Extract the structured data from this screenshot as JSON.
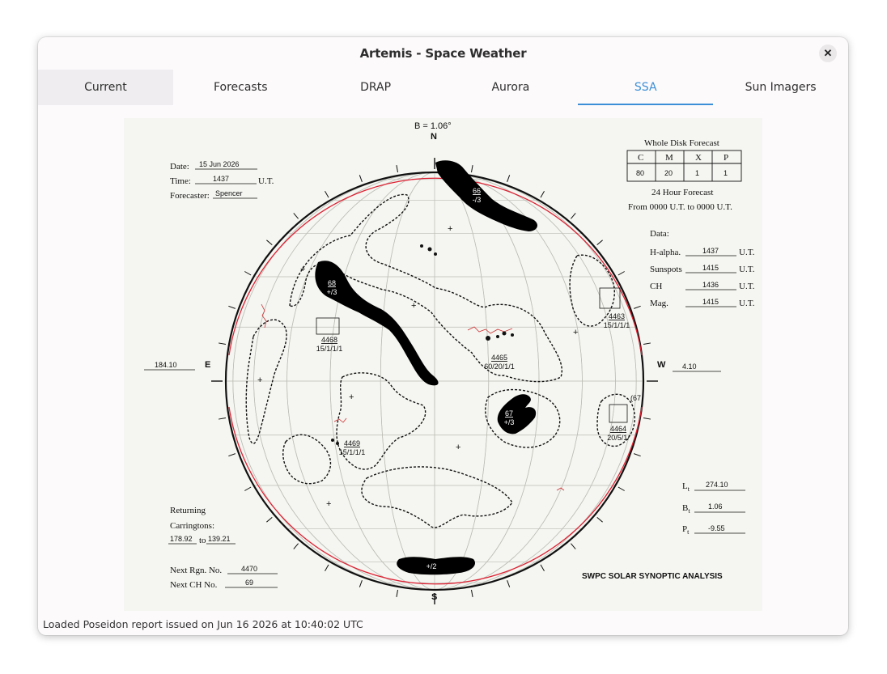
{
  "window": {
    "title": "Artemis - Space Weather",
    "close_icon": "close-icon"
  },
  "tabs": [
    {
      "label": "Current"
    },
    {
      "label": "Forecasts"
    },
    {
      "label": "DRAP"
    },
    {
      "label": "Aurora"
    },
    {
      "label": "SSA"
    },
    {
      "label": "Sun Imagers"
    }
  ],
  "selected_tab": "SSA",
  "ssa": {
    "b_angle": "B = 1.06°",
    "north": "N",
    "south": "S",
    "east": "E",
    "west": "W",
    "date_label": "Date:",
    "date_value": "15 Jun 2026",
    "time_label": "Time:",
    "time_value": "1437",
    "time_unit": "U.T.",
    "forecaster_label": "Forecaster:",
    "forecaster_value": "Spencer",
    "forecast_title": "Whole Disk Forecast",
    "forecast_headers": [
      "C",
      "M",
      "X",
      "P"
    ],
    "forecast_values": [
      "80",
      "20",
      "1",
      "1"
    ],
    "forecast_24h": "24 Hour Forecast",
    "forecast_range": "From 0000 U.T. to 0000 U.T.",
    "data_label": "Data:",
    "data_rows": [
      {
        "label": "H-alpha.",
        "value": "1437",
        "unit": "U.T."
      },
      {
        "label": "Sunspots",
        "value": "1415",
        "unit": "U.T."
      },
      {
        "label": "CH",
        "value": "1436",
        "unit": "U.T."
      },
      {
        "label": "Mag.",
        "value": "1415",
        "unit": "U.T."
      }
    ],
    "east_longitude": "184.10",
    "west_longitude": "4.10",
    "regions": [
      {
        "num": "4463",
        "class": "15/1/1/1"
      },
      {
        "num": "4465",
        "class": "60/20/1/1"
      },
      {
        "num": "4464",
        "class": "20/5/1/"
      },
      {
        "num": "4468",
        "class": "15/1/1/1"
      },
      {
        "num": "4469",
        "class": "15/1/1/1"
      }
    ],
    "coronal_holes": [
      {
        "num": "66",
        "sign": "-/3"
      },
      {
        "num": "68",
        "sign": "+/3"
      },
      {
        "num": "67",
        "sign": "+/3"
      },
      {
        "num": "",
        "sign": "+/2"
      }
    ],
    "edge_label": "(67",
    "lt_label": "L",
    "lt_value": "274.10",
    "bt_label": "B",
    "bt_value": "1.06",
    "pt_label": "P",
    "pt_value": "-9.55",
    "t_sub": "t",
    "returning_label": "Returning",
    "carringtons_label": "Carringtons:",
    "carr_from": "178.92",
    "carr_to_label": "to",
    "carr_to": "139.21",
    "next_rgn_label": "Next Rgn. No.",
    "next_rgn_value": "4470",
    "next_ch_label": "Next CH No.",
    "next_ch_value": "69",
    "footer": "SWPC SOLAR SYNOPTIC ANALYSIS"
  },
  "status": "Loaded Poseidon report issued on Jun 16 2026 at 10:40:02 UTC"
}
